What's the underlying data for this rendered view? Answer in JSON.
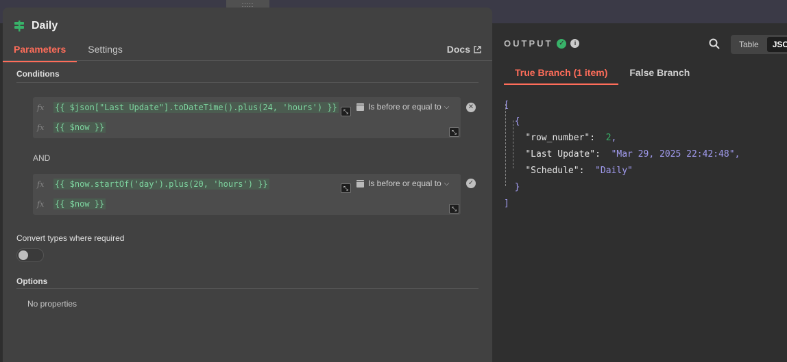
{
  "node": {
    "title": "Daily",
    "tabs": [
      "Parameters",
      "Settings"
    ],
    "docs_label": "Docs"
  },
  "conditions": {
    "section_title": "Conditions",
    "fx_label": "fx",
    "combinator": "AND",
    "items": [
      {
        "left": "{{ $json[\"Last Update\"].toDateTime().plus(24, 'hours') }}",
        "operator": "Is before or equal to",
        "right": "{{ $now }}"
      },
      {
        "left": "{{ $now.startOf('day').plus(20, 'hours') }}",
        "operator": "Is before or equal to",
        "right": "{{ $now }}"
      }
    ]
  },
  "convert": {
    "label": "Convert types where required",
    "enabled": false
  },
  "options": {
    "section_title": "Options",
    "empty_text": "No properties"
  },
  "output": {
    "title": "OUTPUT",
    "views": [
      "Table",
      "JSON"
    ],
    "selected_view": "JSON",
    "branch_tabs": [
      "True Branch (1 item)",
      "False Branch"
    ],
    "json": {
      "row_number_key": "\"row_number\"",
      "row_number_val": "2",
      "last_update_key": "\"Last Update\"",
      "last_update_val": "\"Mar 29, 2025 22:42:48\"",
      "schedule_key": "\"Schedule\"",
      "schedule_val": "\"Daily\""
    }
  },
  "colors": {
    "accent": "#ff6d5a",
    "success": "#38b269",
    "expression": "#7ed5a0",
    "json_string": "#a29cf0"
  }
}
